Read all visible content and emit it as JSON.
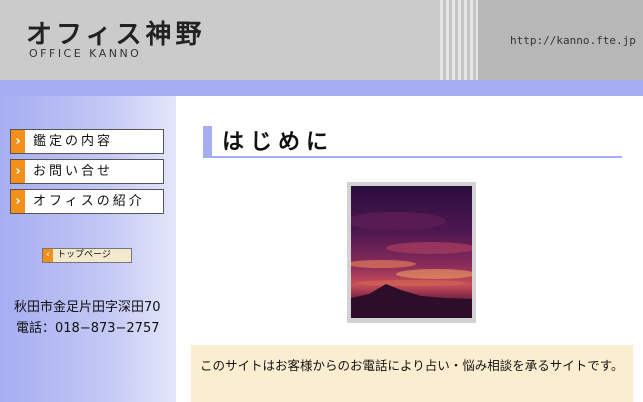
{
  "header": {
    "logo_jp": "オフィス神野",
    "logo_en": "OFFICE KANNO",
    "url": "http://kanno.fte.jp"
  },
  "sidebar": {
    "nav": [
      {
        "label": "鑑定の内容"
      },
      {
        "label": "お問い合せ"
      },
      {
        "label": "オフィスの紹介"
      }
    ],
    "top_button": "トップページ",
    "address": "秋田市金足片田字深田70",
    "phone": "電話：018−873−2757"
  },
  "main": {
    "heading": "はじめに",
    "intro": "このサイトはお客様からのお電話により占い・悩み相談を承るサイトです。"
  },
  "colors": {
    "accent_blue": "#a6adf2",
    "accent_orange": "#f4901a",
    "intro_bg": "#fbedd0"
  }
}
